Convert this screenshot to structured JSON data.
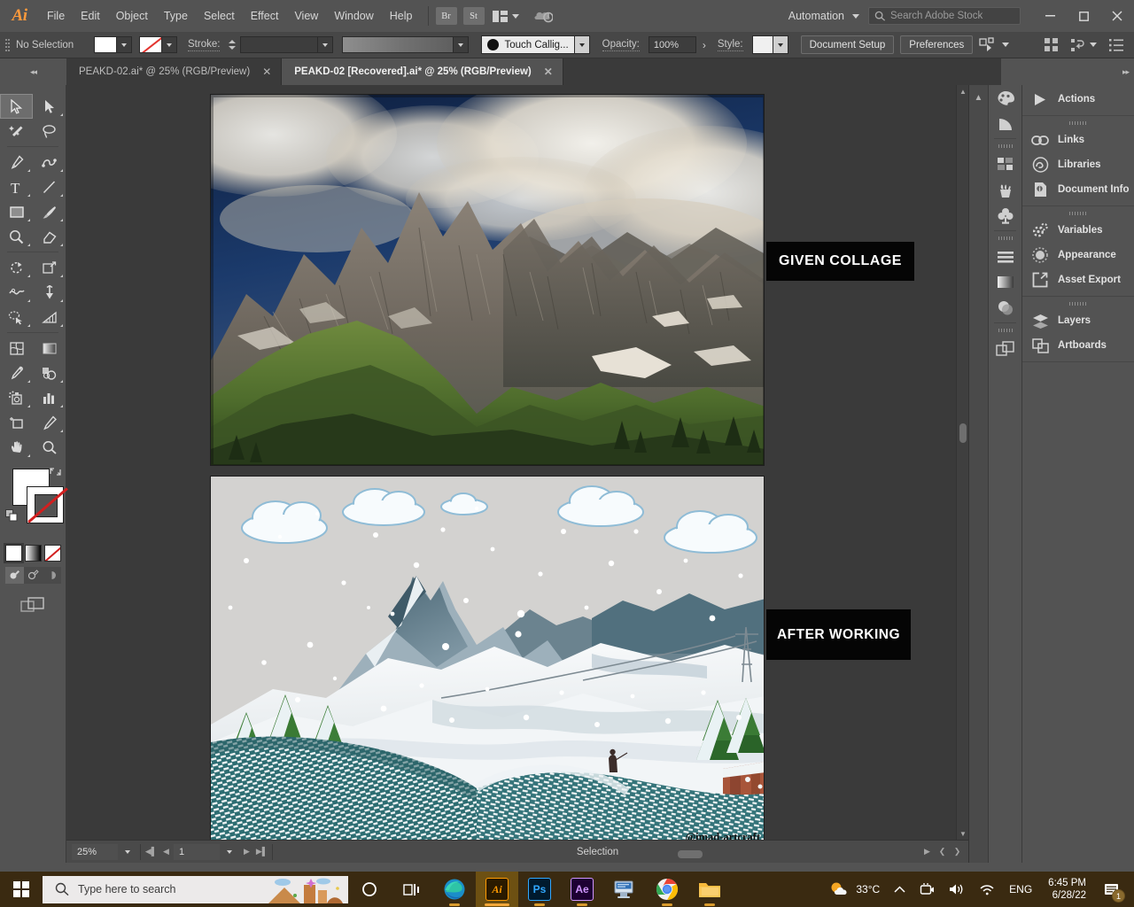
{
  "app": {
    "name": "Adobe Illustrator",
    "logo_text": "Ai"
  },
  "menubar": {
    "items": [
      "File",
      "Edit",
      "Object",
      "Type",
      "Select",
      "Effect",
      "View",
      "Window",
      "Help"
    ],
    "bridge_label": "Br",
    "stock_label": "St",
    "automation_label": "Automation",
    "search_placeholder": "Search Adobe Stock",
    "minimize_label": "–",
    "maximize_label": "❐",
    "close_label": "✕"
  },
  "controlbar": {
    "selection_status": "No Selection",
    "stroke_label": "Stroke:",
    "stroke_weight": "",
    "brush_label": "Touch Callig...",
    "opacity_label": "Opacity:",
    "opacity_value": "100%",
    "opacity_more": "›",
    "style_label": "Style:",
    "document_setup_label": "Document Setup",
    "preferences_label": "Preferences"
  },
  "tabs": [
    {
      "title": "PEAKD-02.ai* @ 25% (RGB/Preview)",
      "active": false,
      "close": "✕"
    },
    {
      "title": "PEAKD-02 [Recovered].ai* @ 25% (RGB/Preview)",
      "active": true,
      "close": "✕"
    }
  ],
  "toolbar": {
    "tools": [
      "selection-tool",
      "direct-selection-tool",
      "magic-wand-tool",
      "lasso-tool",
      "pen-tool",
      "curvature-tool",
      "type-tool",
      "line-segment-tool",
      "rectangle-tool",
      "paintbrush-tool",
      "shaper-tool",
      "eraser-tool",
      "rotate-tool",
      "scale-tool",
      "width-tool",
      "free-transform-tool",
      "shape-builder-tool",
      "perspective-grid-tool",
      "mesh-tool",
      "gradient-tool",
      "eyedropper-tool",
      "blend-tool",
      "symbol-sprayer-tool",
      "column-graph-tool",
      "artboard-tool",
      "slice-tool",
      "hand-tool",
      "zoom-tool"
    ],
    "fill_color": "#ffffff",
    "stroke_color": "#ffffff",
    "color_modes": [
      "color-mode",
      "gradient-mode",
      "none-mode"
    ],
    "draw_modes": [
      "draw-normal",
      "draw-behind",
      "draw-inside"
    ],
    "screen_mode": "change-screen-mode"
  },
  "status_bar": {
    "zoom_value": "25%",
    "page_value": "1",
    "status_text": "Selection"
  },
  "dock_icons": [
    "color-panel-icon",
    "color-guide-icon",
    "swatches-icon",
    "brushes-icon",
    "symbols-icon",
    "align-icon",
    "gradient-icon",
    "transparency-icon",
    "pathfinder-icon"
  ],
  "dock_panel": {
    "groups": [
      {
        "items": [
          {
            "label": "Actions",
            "icon": "play-icon"
          }
        ]
      },
      {
        "items": [
          {
            "label": "Links",
            "icon": "link-icon"
          },
          {
            "label": "Libraries",
            "icon": "cc-libraries-icon"
          },
          {
            "label": "Document Info",
            "icon": "info-document-icon"
          }
        ]
      },
      {
        "items": [
          {
            "label": "Variables",
            "icon": "gears-icon"
          },
          {
            "label": "Appearance",
            "icon": "appearance-circle-icon"
          },
          {
            "label": "Asset Export",
            "icon": "export-arrow-icon"
          }
        ]
      },
      {
        "items": [
          {
            "label": "Layers",
            "icon": "layers-stack-icon"
          },
          {
            "label": "Artboards",
            "icon": "artboards-icon"
          }
        ]
      }
    ]
  },
  "canvas": {
    "artboard_top_name": "given-collage-photo",
    "artboard_bottom_name": "after-working-illustration",
    "label_given": "GIVEN COLLAGE",
    "label_after": "AFTER WORKING",
    "watermark": "@imad-artcraft"
  },
  "taskbar": {
    "search_placeholder": "Type here to search",
    "apps": [
      {
        "name": "task-view",
        "label": ""
      },
      {
        "name": "microsoft-edge",
        "label": ""
      },
      {
        "name": "adobe-illustrator",
        "label": "Ai"
      },
      {
        "name": "adobe-photoshop",
        "label": "Ps"
      },
      {
        "name": "adobe-after-effects",
        "label": "Ae"
      },
      {
        "name": "remote-desktop",
        "label": ""
      },
      {
        "name": "google-chrome",
        "label": ""
      },
      {
        "name": "file-explorer",
        "label": ""
      }
    ],
    "weather_temp": "33°C",
    "language": "ENG",
    "time": "6:45 PM",
    "date": "6/28/22",
    "notification_count": "1"
  },
  "colors": {
    "accent": "#ff9a3c",
    "chrome": "#535353",
    "panel": "#474747",
    "canvas_bg": "#3a3a3a",
    "taskbar": "#3a2a11",
    "label_bg": "#050505"
  }
}
